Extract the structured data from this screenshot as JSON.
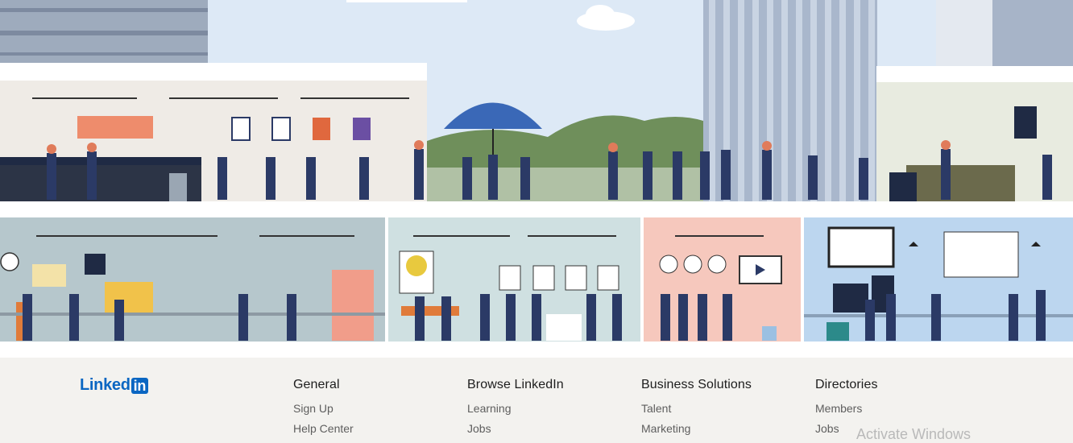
{
  "brand": {
    "logo_text": "Linked",
    "logo_box": "in",
    "color": "#0a66c2"
  },
  "footer": {
    "columns": [
      {
        "title": "General",
        "links": [
          "Sign Up",
          "Help Center"
        ]
      },
      {
        "title": "Browse LinkedIn",
        "links": [
          "Learning",
          "Jobs"
        ]
      },
      {
        "title": "Business Solutions",
        "links": [
          "Talent",
          "Marketing"
        ]
      },
      {
        "title": "Directories",
        "links": [
          "Members",
          "Jobs"
        ]
      }
    ]
  },
  "overlay": {
    "activate_windows": "Activate Windows"
  },
  "colors": {
    "background": "#f3f2ef",
    "sky": "#d9e8f7",
    "hill": "#6f8f5b",
    "cafe_wall": "#efebe6"
  }
}
